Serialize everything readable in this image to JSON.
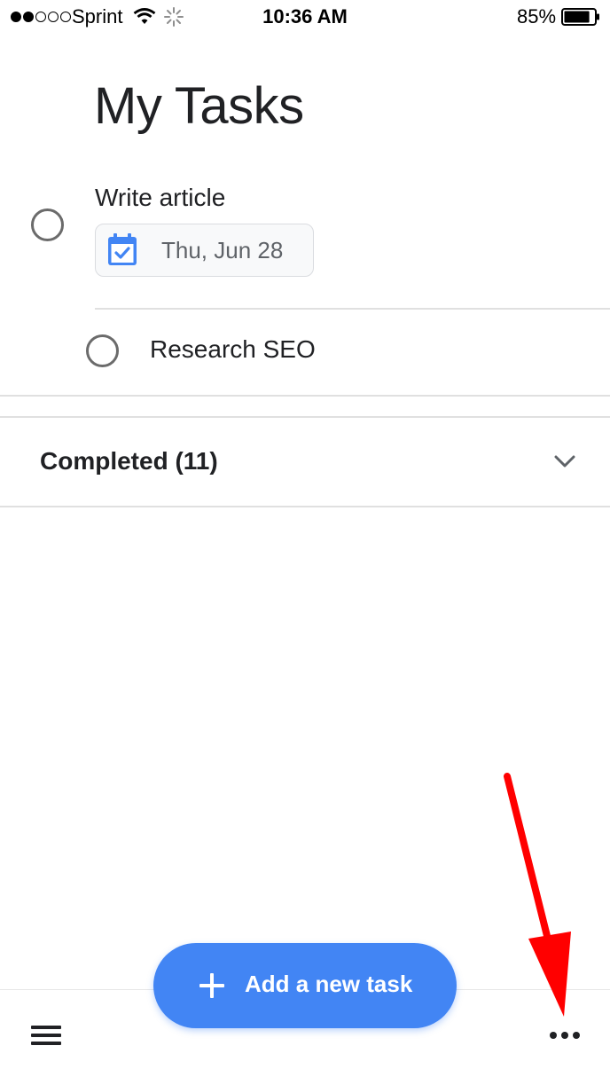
{
  "status_bar": {
    "carrier": "Sprint",
    "time": "10:36 AM",
    "battery_percent": "85%",
    "battery_level": 0.85,
    "signal_bars_filled": 2,
    "signal_bars_total": 5,
    "wifi_icon": "wifi-icon",
    "activity_icon": "loading-spinner-icon"
  },
  "header": {
    "title": "My Tasks"
  },
  "tasks": [
    {
      "title": "Write article",
      "due_date": "Thu, Jun 28",
      "due_icon": "calendar-check-icon",
      "completed": false
    },
    {
      "title": "Research SEO",
      "completed": false
    }
  ],
  "completed_section": {
    "label": "Completed (11)",
    "expand_icon": "chevron-down-icon"
  },
  "fab": {
    "label": "Add a new task",
    "icon": "plus-icon"
  },
  "bottom_bar": {
    "menu_icon": "hamburger-menu-icon",
    "more_icon": "more-horizontal-icon"
  },
  "colors": {
    "accent": "#4285f4",
    "text_primary": "#202124",
    "text_secondary": "#5f6368",
    "annotation": "#ff0000"
  }
}
